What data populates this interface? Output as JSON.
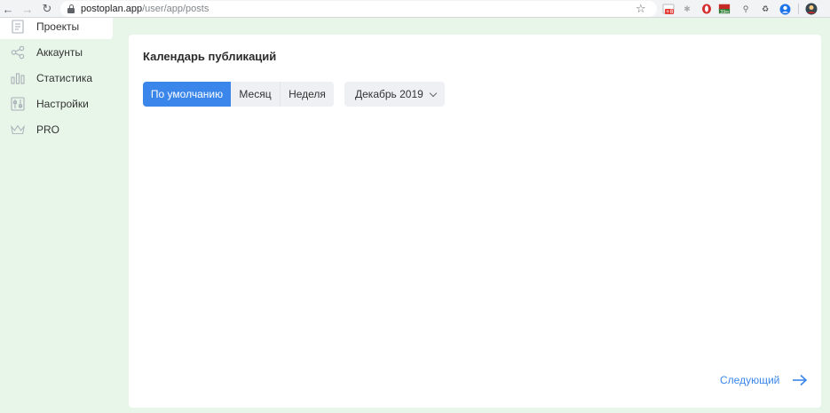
{
  "browser": {
    "url_host": "postoplan.app",
    "url_path": "/user/app/posts",
    "ext_badge_1": "+8",
    "ext_badge_2": "39м"
  },
  "sidebar": {
    "items": [
      {
        "label": "Проекты",
        "icon": "document-icon"
      },
      {
        "label": "Аккаунты",
        "icon": "share-icon"
      },
      {
        "label": "Статистика",
        "icon": "bar-chart-icon"
      },
      {
        "label": "Настройки",
        "icon": "sliders-icon"
      },
      {
        "label": "PRO",
        "icon": "crown-icon"
      }
    ]
  },
  "main": {
    "title": "Календарь публикаций",
    "view_tabs": [
      {
        "label": "По умолчанию",
        "active": true
      },
      {
        "label": "Месяц",
        "active": false
      },
      {
        "label": "Неделя",
        "active": false
      }
    ],
    "month_select": "Декабрь 2019",
    "next_label": "Следующий"
  },
  "colors": {
    "accent": "#3a86ea",
    "page_bg": "#e8f6ea",
    "segment_bg": "#eef0f3"
  }
}
